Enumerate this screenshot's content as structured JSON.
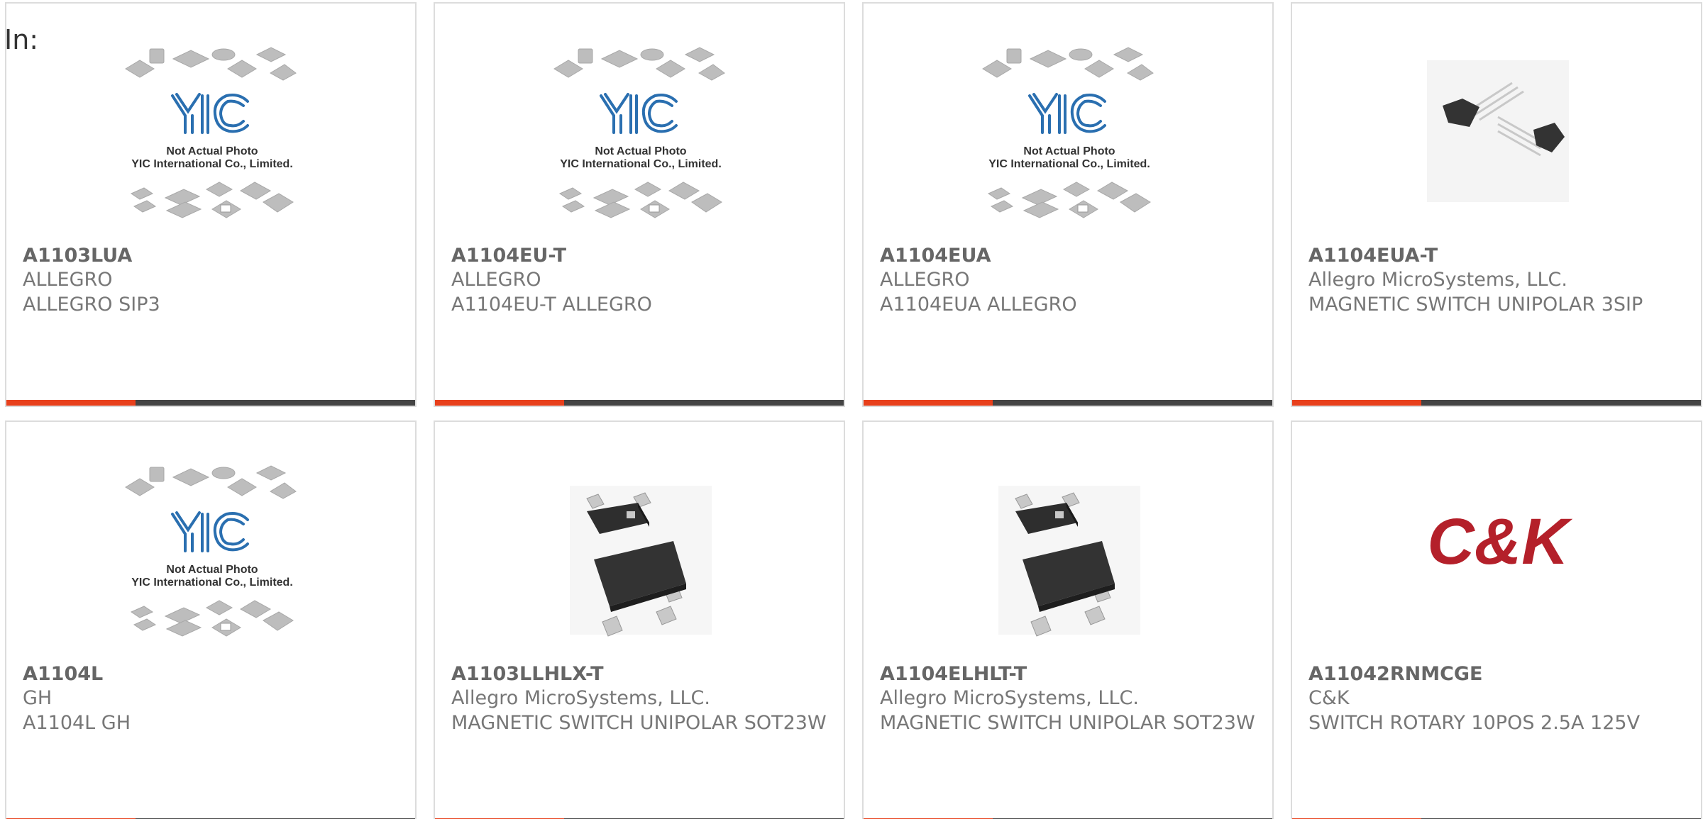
{
  "filter_label": "In:",
  "colors": {
    "accent": "#e8401c",
    "bar": "#444444",
    "border": "#dcdcdc",
    "text": "#777777"
  },
  "products": [
    {
      "part": "A1103LUA",
      "maker": "ALLEGRO",
      "desc": "ALLEGRO SIP3",
      "image": "yic-placeholder",
      "yic_text1": "Not Actual Photo",
      "yic_text2": "YIC International Co., Limited."
    },
    {
      "part": "A1104EU-T",
      "maker": "ALLEGRO",
      "desc": "A1104EU-T ALLEGRO",
      "image": "yic-placeholder",
      "yic_text1": "Not Actual Photo",
      "yic_text2": "YIC International Co., Limited."
    },
    {
      "part": "A1104EUA",
      "maker": "ALLEGRO",
      "desc": "A1104EUA ALLEGRO",
      "image": "yic-placeholder",
      "yic_text1": "Not Actual Photo",
      "yic_text2": "YIC International Co., Limited."
    },
    {
      "part": "A1104EUA-T",
      "maker": "Allegro MicroSystems, LLC.",
      "desc": "MAGNETIC SWITCH UNIPOLAR 3SIP",
      "image": "to92-sensor"
    },
    {
      "part": "A1104L",
      "maker": "GH",
      "desc": "A1104L GH",
      "image": "yic-placeholder",
      "yic_text1": "Not Actual Photo",
      "yic_text2": "YIC International Co., Limited."
    },
    {
      "part": "A1103LLHLX-T",
      "maker": "Allegro MicroSystems, LLC.",
      "desc": "MAGNETIC SWITCH UNIPOLAR SOT23W",
      "image": "sot23-package"
    },
    {
      "part": "A1104ELHLT-T",
      "maker": "Allegro MicroSystems, LLC.",
      "desc": "MAGNETIC SWITCH UNIPOLAR SOT23W",
      "image": "sot23-package"
    },
    {
      "part": "A11042RNMCGE",
      "maker": "C&K",
      "desc": "SWITCH ROTARY 10POS 2.5A 125V",
      "image": "ck-logo",
      "logo_text": "C&K"
    }
  ]
}
